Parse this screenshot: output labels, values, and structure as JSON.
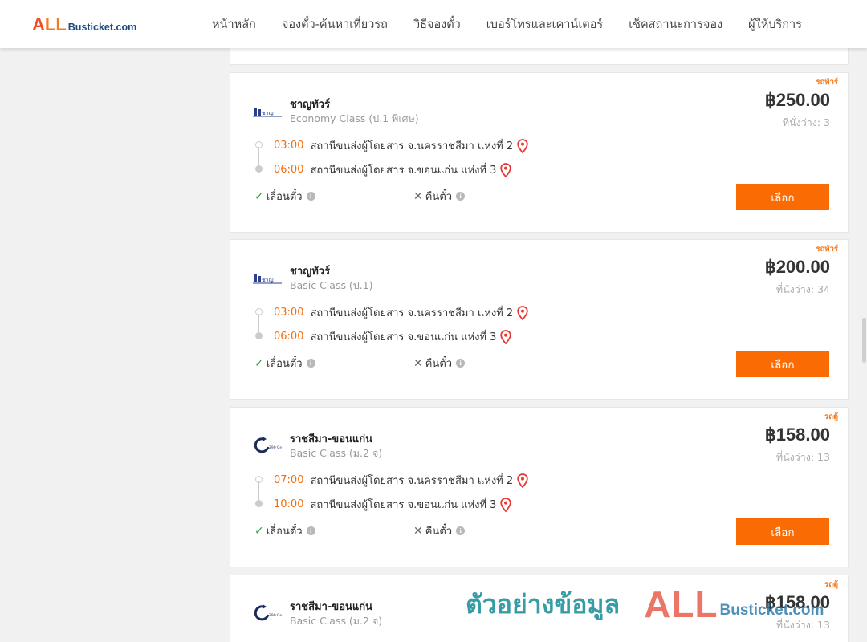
{
  "header": {
    "logo": {
      "all": "ALL",
      "site": "Busticket.com"
    },
    "nav": [
      "หน้าหลัก",
      "จองตั๋ว-ค้นหาเที่ยวรถ",
      "วิธีจองตั๋ว",
      "เบอร์โทรและเคาน์เตอร์",
      "เช็คสถานะการจอง",
      "ผู้ให้บริการ"
    ]
  },
  "trips": [
    {
      "badge": "รถทัวร์",
      "operator": "ชาญทัวร์",
      "class": "Economy Class (ป.1 พิเศษ)",
      "price": "฿250.00",
      "seats": "ที่นั่งว่าง: 3",
      "depart_time": "03:00",
      "depart_place": "สถานีขนส่งผู้โดยสาร จ.นครราชสีมา แห่งที่ 2",
      "arrive_time": "06:00",
      "arrive_place": "สถานีขนส่งผู้โดยสาร จ.ขอนแก่น แห่งที่ 3",
      "reschedule": "เลื่อนตั๋ว",
      "refund": "คืนตั๋ว",
      "button": "เลือก"
    },
    {
      "badge": "รถทัวร์",
      "operator": "ชาญทัวร์",
      "class": "Basic Class (ป.1)",
      "price": "฿200.00",
      "seats": "ที่นั่งว่าง: 34",
      "depart_time": "03:00",
      "depart_place": "สถานีขนส่งผู้โดยสาร จ.นครราชสีมา แห่งที่ 2",
      "arrive_time": "06:00",
      "arrive_place": "สถานีขนส่งผู้โดยสาร จ.ขอนแก่น แห่งที่ 3",
      "reschedule": "เลื่อนตั๋ว",
      "refund": "คืนตั๋ว",
      "button": "เลือก"
    },
    {
      "badge": "รถตู้",
      "operator": "ราชสีมา-ขอนแก่น",
      "class": "Basic Class (ม.2 จ)",
      "price": "฿158.00",
      "seats": "ที่นั่งว่าง: 13",
      "depart_time": "07:00",
      "depart_place": "สถานีขนส่งผู้โดยสาร จ.นครราชสีมา แห่งที่ 2",
      "arrive_time": "10:00",
      "arrive_place": "สถานีขนส่งผู้โดยสาร จ.ขอนแก่น แห่งที่ 3",
      "reschedule": "เลื่อนตั๋ว",
      "refund": "คืนตั๋ว",
      "button": "เลือก"
    },
    {
      "badge": "รถตู้",
      "operator": "ราชสีมา-ขอนแก่น",
      "class": "Basic Class (ม.2 จ)",
      "price": "฿158.00",
      "seats": "ที่นั่งว่าง: 13"
    }
  ],
  "watermark": {
    "text": "ตัวอย่างข้อมูล",
    "all": "ALL",
    "site": "Busticket.com"
  },
  "colors": {
    "accent": "#fb6b04",
    "time": "#f26d0f",
    "badge": "#f47a20",
    "pin": "#e53935",
    "check": "#2e9e44"
  }
}
